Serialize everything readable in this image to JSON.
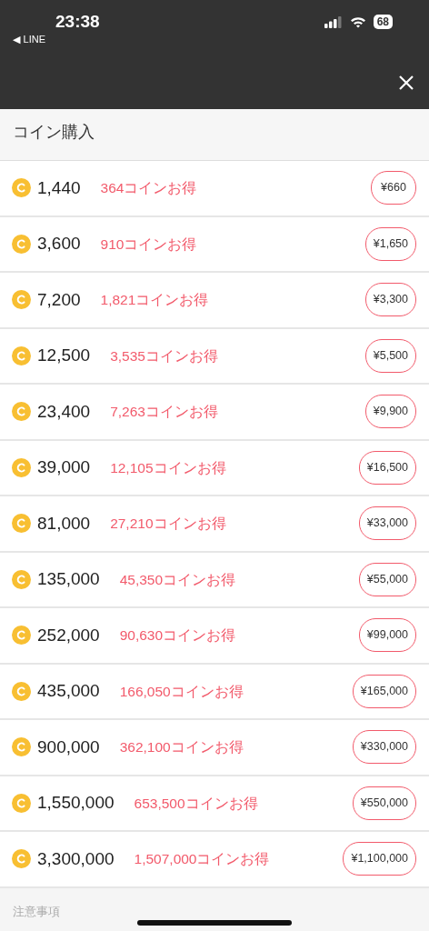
{
  "status_bar": {
    "time": "23:38",
    "back_app": "◀ LINE",
    "battery": "68"
  },
  "title": "コイン購入",
  "packages": [
    {
      "coins": "1,440",
      "bonus": "364コインお得",
      "price": "¥660"
    },
    {
      "coins": "3,600",
      "bonus": "910コインお得",
      "price": "¥1,650"
    },
    {
      "coins": "7,200",
      "bonus": "1,821コインお得",
      "price": "¥3,300"
    },
    {
      "coins": "12,500",
      "bonus": "3,535コインお得",
      "price": "¥5,500"
    },
    {
      "coins": "23,400",
      "bonus": "7,263コインお得",
      "price": "¥9,900"
    },
    {
      "coins": "39,000",
      "bonus": "12,105コインお得",
      "price": "¥16,500"
    },
    {
      "coins": "81,000",
      "bonus": "27,210コインお得",
      "price": "¥33,000"
    },
    {
      "coins": "135,000",
      "bonus": "45,350コインお得",
      "price": "¥55,000"
    },
    {
      "coins": "252,000",
      "bonus": "90,630コインお得",
      "price": "¥99,000"
    },
    {
      "coins": "435,000",
      "bonus": "166,050コインお得",
      "price": "¥165,000"
    },
    {
      "coins": "900,000",
      "bonus": "362,100コインお得",
      "price": "¥330,000"
    },
    {
      "coins": "1,550,000",
      "bonus": "653,500コインお得",
      "price": "¥550,000"
    },
    {
      "coins": "3,300,000",
      "bonus": "1,507,000コインお得",
      "price": "¥1,100,000"
    }
  ],
  "notes": {
    "heading": "注意事項"
  }
}
